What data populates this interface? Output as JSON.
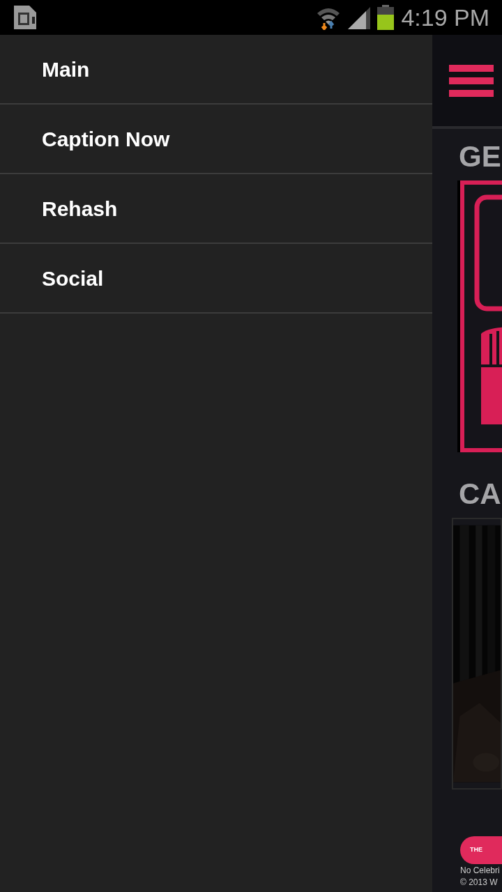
{
  "status_bar": {
    "time": "4:19 PM"
  },
  "drawer": {
    "items": [
      {
        "label": "Main"
      },
      {
        "label": "Caption Now"
      },
      {
        "label": "Rehash"
      },
      {
        "label": "Social"
      }
    ]
  },
  "background_screen": {
    "sections": [
      {
        "title": "GE",
        "kind": "promo"
      },
      {
        "title": "CA",
        "kind": "picture"
      }
    ],
    "footer": {
      "logo_text": "THE",
      "lines": [
        "No Celebri",
        "© 2013 W"
      ]
    }
  }
}
